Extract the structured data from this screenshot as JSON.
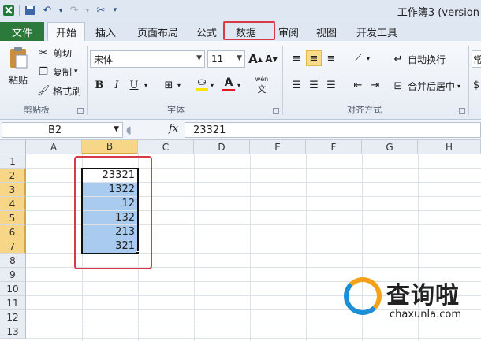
{
  "title_bar": {
    "title": "工作簿3 (version"
  },
  "tabs": {
    "file": "文件",
    "items": [
      "开始",
      "插入",
      "页面布局",
      "公式",
      "数据",
      "审阅",
      "视图",
      "开发工具"
    ]
  },
  "ribbon": {
    "clipboard": {
      "paste": "粘贴",
      "cut": "剪切",
      "copy": "复制",
      "format_painter": "格式刷",
      "label": "剪贴板"
    },
    "font": {
      "name": "宋体",
      "size": "11",
      "bold": "B",
      "italic": "I",
      "underline": "U",
      "grow": "A",
      "shrink": "A",
      "color_a": "A",
      "wen": "wén",
      "label": "字体"
    },
    "alignment": {
      "wrap_text": "自动换行",
      "merge_center": "合并后居中",
      "label": "对齐方式"
    },
    "number": {
      "format": "常"
    }
  },
  "formula_bar": {
    "name_box": "B2",
    "fx": "fx",
    "content": "23321"
  },
  "grid": {
    "columns": [
      "A",
      "B",
      "C",
      "D",
      "E",
      "F",
      "G",
      "H"
    ],
    "rows": [
      "1",
      "2",
      "3",
      "4",
      "5",
      "6",
      "7",
      "8",
      "9",
      "10",
      "11",
      "12",
      "13"
    ],
    "b_values": [
      "23321",
      "1322",
      "12",
      "132",
      "213",
      "321"
    ]
  },
  "watermark": {
    "brand": "查询啦",
    "domain": "chaxunla.com"
  },
  "colors": {
    "file_tab": "#2b7a3b",
    "highlight_box": "#d93b46",
    "selection_fill": "#a9cbef",
    "header_selected": "#f8d688"
  }
}
